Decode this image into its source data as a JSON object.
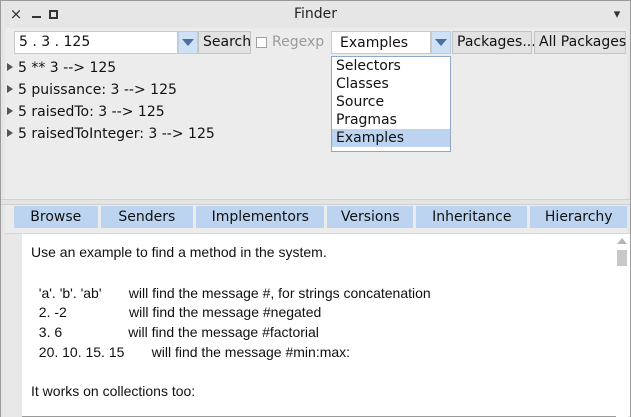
{
  "window": {
    "title": "Finder",
    "close_glyph": "×",
    "menu_glyph": "▾"
  },
  "toolbar": {
    "search_value": "5 . 3 . 125",
    "search_button": "Search",
    "regexp_label": "Regexp",
    "regexp_checked": false,
    "scope_selected": "Examples",
    "packages_button": "Packages...",
    "all_packages_button": "All Packages"
  },
  "scope_options": [
    "Selectors",
    "Classes",
    "Source",
    "Pragmas",
    "Examples"
  ],
  "results": [
    "5 ** 3 --> 125",
    "5 puissance: 3 --> 125",
    "5 raisedTo: 3 --> 125",
    "5 raisedToInteger: 3 --> 125"
  ],
  "tabs": [
    "Browse",
    "Senders",
    "Implementors",
    "Versions",
    "Inheritance",
    "Hierarchy"
  ],
  "description_lines": [
    "Use an example to find a method in the system.",
    "",
    "  'a'. 'b'. 'ab'       will find the message #, for strings concatenation",
    "  2. -2                will find the message #negated",
    "  3. 6                 will find the message #factorial",
    "  20. 10. 15. 15       will find the message #min:max:",
    "",
    "It works on collections too:"
  ],
  "colors": {
    "accent": "#bcd4ef",
    "combo_arrow": "#cfe2f5",
    "window_bg": "#ececec"
  },
  "icons": {
    "close": "close-icon",
    "minimize": "minimize-icon",
    "maximize": "maximize-icon",
    "window_menu": "chevron-down-icon",
    "combo": "chevron-down-icon",
    "expand": "triangle-right-icon"
  }
}
